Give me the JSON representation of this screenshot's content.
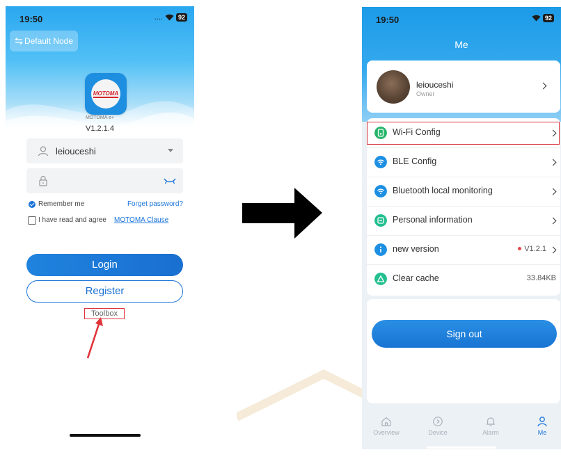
{
  "left_screen": {
    "status_time": "19:50",
    "status_signal": "....",
    "status_battery": "92",
    "node_button_label": "Default Node",
    "app_name": "MOTOMA e+",
    "app_logo_text": "MOTOMA",
    "version": "V1.2.1.4",
    "username_value": "leiouceshi",
    "remember_label": "Remember me",
    "forget_label": "Forget password?",
    "agree_label": "I have read and agree",
    "clause_link": "MOTOMA Clause",
    "login_label": "Login",
    "register_label": "Register",
    "toolbox_label": "Toolbox",
    "highlight_color": "#e0333a"
  },
  "right_screen": {
    "status_time": "19:50",
    "status_battery": "92",
    "title": "Me",
    "profile": {
      "name": "leiouceshi",
      "role": "Owner"
    },
    "menu": [
      {
        "label": "Wi-Fi Config",
        "icon": "wifi-config-icon",
        "color": "#27b56b",
        "value": ""
      },
      {
        "label": "BLE Config",
        "icon": "ble-config-icon",
        "color": "#1c8fe3",
        "value": ""
      },
      {
        "label": "Bluetooth local monitoring",
        "icon": "bluetooth-monitor-icon",
        "color": "#1c8fe3",
        "value": ""
      },
      {
        "label": "Personal information",
        "icon": "personal-info-icon",
        "color": "#23bf8f",
        "value": ""
      },
      {
        "label": "new version",
        "icon": "new-version-icon",
        "color": "#1c8fe3",
        "value": "V1.2.1"
      },
      {
        "label": "Clear cache",
        "icon": "clear-cache-icon",
        "color": "#23bf8f",
        "value": "33.84KB"
      }
    ],
    "sign_out_label": "Sign out",
    "tabs": [
      {
        "label": "Overview",
        "icon": "home-icon"
      },
      {
        "label": "Device",
        "icon": "device-icon"
      },
      {
        "label": "Alarm",
        "icon": "bell-icon"
      },
      {
        "label": "Me",
        "icon": "person-icon",
        "active": true
      }
    ],
    "accent": "#1a73d9"
  }
}
